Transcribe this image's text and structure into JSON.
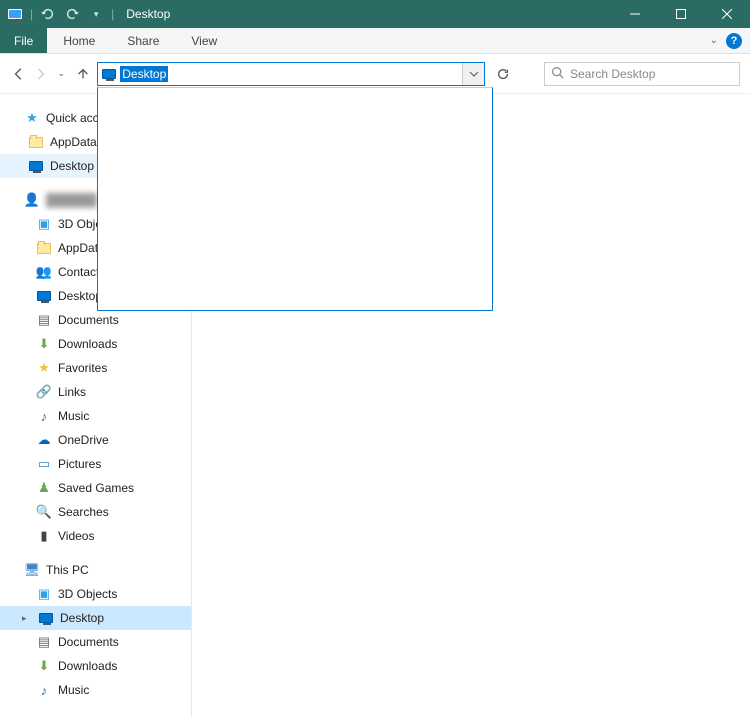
{
  "window": {
    "title": "Desktop"
  },
  "ribbon": {
    "file": "File",
    "tabs": [
      "Home",
      "Share",
      "View"
    ]
  },
  "nav": {
    "address_value": "Desktop",
    "search_placeholder": "Search Desktop"
  },
  "tree": {
    "quick_access": "Quick access",
    "qa_items": [
      {
        "icon": "folder",
        "label": "AppData",
        "pinned": true
      },
      {
        "icon": "desktop",
        "label": "Desktop",
        "selected": true
      }
    ],
    "user_label": "",
    "user_items": [
      {
        "icon": "3d",
        "label": "3D Objects"
      },
      {
        "icon": "folder",
        "label": "AppData"
      },
      {
        "icon": "contacts",
        "label": "Contacts"
      },
      {
        "icon": "desktop",
        "label": "Desktop"
      },
      {
        "icon": "doc",
        "label": "Documents"
      },
      {
        "icon": "dl",
        "label": "Downloads"
      },
      {
        "icon": "fav",
        "label": "Favorites"
      },
      {
        "icon": "link",
        "label": "Links"
      },
      {
        "icon": "music",
        "label": "Music"
      },
      {
        "icon": "onedrive",
        "label": "OneDrive"
      },
      {
        "icon": "pic",
        "label": "Pictures"
      },
      {
        "icon": "saved",
        "label": "Saved Games"
      },
      {
        "icon": "search",
        "label": "Searches"
      },
      {
        "icon": "video",
        "label": "Videos"
      }
    ],
    "this_pc": "This PC",
    "pc_items": [
      {
        "icon": "3d",
        "label": "3D Objects"
      },
      {
        "icon": "desktop",
        "label": "Desktop",
        "selected": true,
        "expand": true
      },
      {
        "icon": "doc",
        "label": "Documents"
      },
      {
        "icon": "dl",
        "label": "Downloads"
      },
      {
        "icon": "music",
        "label": "Music"
      }
    ]
  },
  "colors": {
    "titlebar": "#2a6b64",
    "accent": "#0078d4",
    "selection": "#cce8ff"
  }
}
